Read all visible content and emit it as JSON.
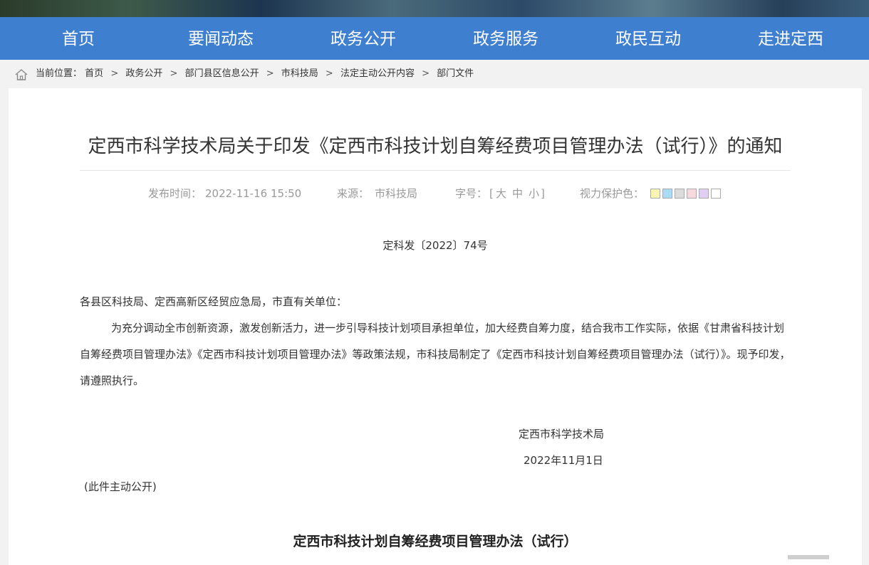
{
  "nav": [
    "首页",
    "要闻动态",
    "政务公开",
    "政务服务",
    "政民互动",
    "走进定西"
  ],
  "breadcrumb": {
    "label": "当前位置：",
    "items": [
      "首页",
      "政务公开",
      "部门县区信息公开",
      "市科技局",
      "法定主动公开内容",
      "部门文件"
    ]
  },
  "article": {
    "title": "定西市科学技术局关于印发《定西市科技计划自筹经费项目管理办法（试行）》的通知",
    "publish_label": "发布时间：",
    "publish_time": "2022-11-16 15:50",
    "source_label": "来源：",
    "source": "市科技局",
    "font_label": "字号：",
    "font_bracket_l": "[",
    "font_large": "大",
    "font_mid": "中",
    "font_small": "小",
    "font_bracket_r": "]",
    "color_label": "视力保护色：",
    "color_swatches": [
      "#faf4b4",
      "#a9dcf5",
      "#dcdcdc",
      "#f7d9df",
      "#e2cdf3",
      "#ffffff"
    ],
    "doc_no": "定科发〔2022〕74号",
    "salutation": "各县区科技局、定西高新区经贸应急局，市直有关单位：",
    "body": "为充分调动全市创新资源，激发创新活力，进一步引导科技计划项目承担单位，加大经费自筹力度，结合我市工作实际，依据《甘肃省科技计划自筹经费项目管理办法》《定西市科技计划项目管理办法》等政策法规，市科技局制定了《定西市科技计划自筹经费项目管理办法（试行）》。现予印发，请遵照执行。",
    "signer": "定西市科学技术局",
    "date": "2022年11月1日",
    "note": "(此件主动公开)",
    "subtitle": "定西市科技计划自筹经费项目管理办法（试行）"
  }
}
